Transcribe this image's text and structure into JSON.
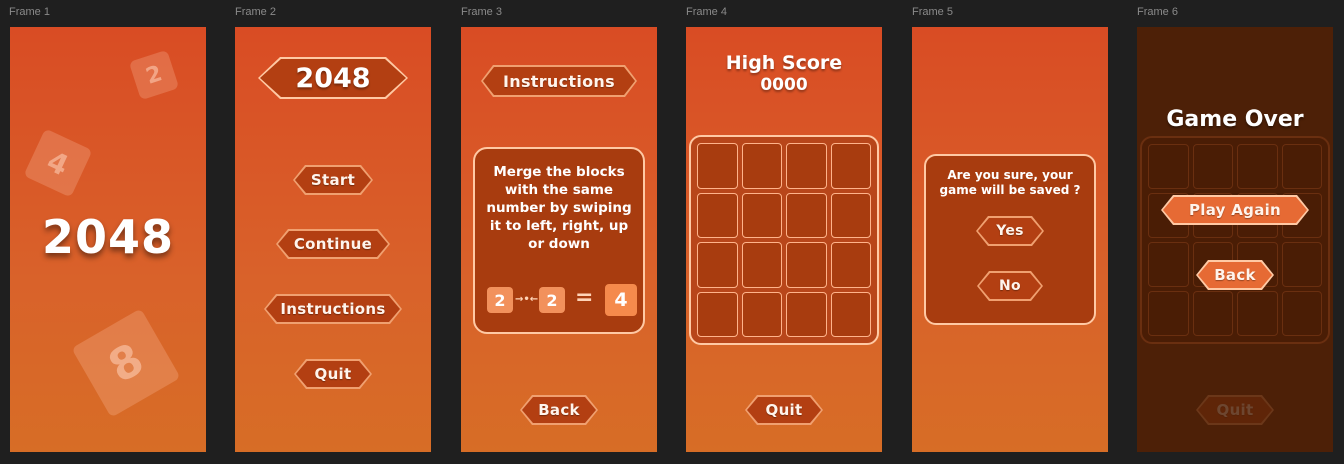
{
  "frames": [
    {
      "label": "Frame 1"
    },
    {
      "label": "Frame 2"
    },
    {
      "label": "Frame 3"
    },
    {
      "label": "Frame 4"
    },
    {
      "label": "Frame 5"
    },
    {
      "label": "Frame 6"
    }
  ],
  "splash": {
    "title": "2048",
    "tiles": [
      "2",
      "4",
      "8"
    ]
  },
  "menu": {
    "title": "2048",
    "buttons": [
      "Start",
      "Continue",
      "Instructions",
      "Quit"
    ]
  },
  "instructions": {
    "title": "Instructions",
    "text": "Merge the blocks with the same number by swiping it to left, right, up or down",
    "example": {
      "a": "2",
      "b": "2",
      "eq": "=",
      "result": "4"
    },
    "back": "Back"
  },
  "highscore": {
    "title": "High Score",
    "score": "0000",
    "quit": "Quit"
  },
  "confirm": {
    "question": "Are you sure, your game will be saved ?",
    "yes": "Yes",
    "no": "No"
  },
  "gameover": {
    "title": "Game Over",
    "play_again": "Play Again",
    "back": "Back",
    "quit": "Quit"
  },
  "colors": {
    "background": "#1f1f1f",
    "frame_gradient_top": "#d94c24",
    "frame_gradient_bottom": "#d76d26",
    "button_fill": "#b33f12",
    "button_border": "#ffc9a4",
    "dark_frame": "#4d2007"
  }
}
